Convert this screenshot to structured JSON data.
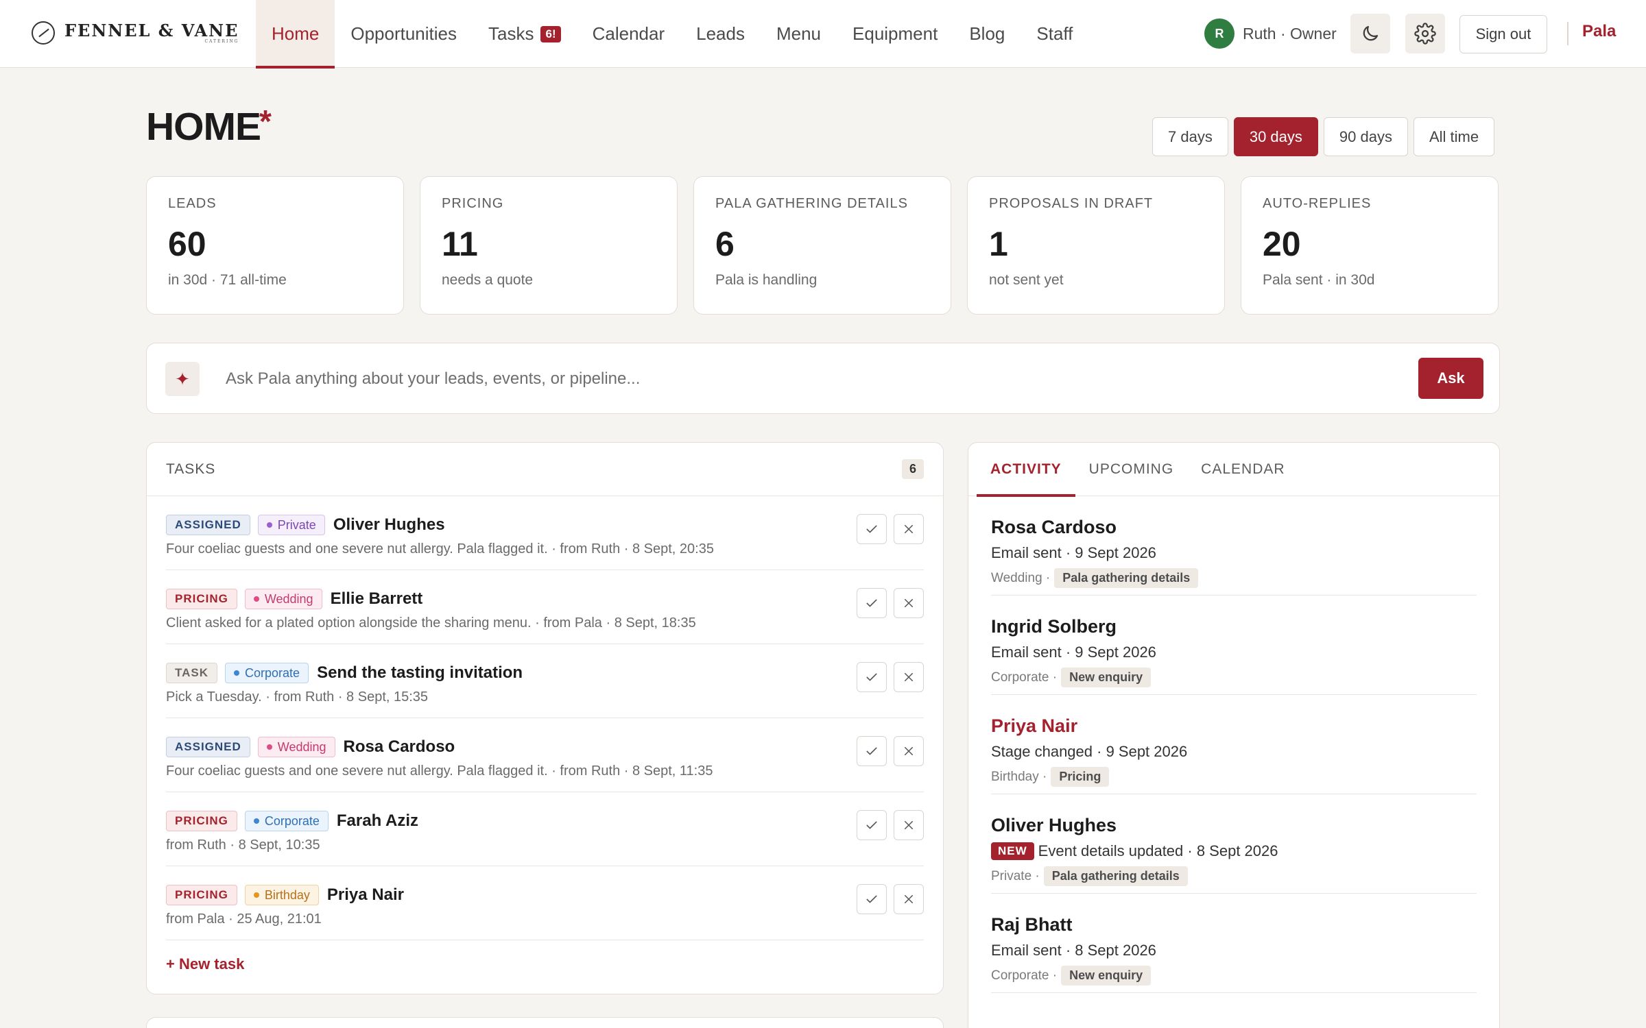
{
  "brand": {
    "name": "FENNEL & VANE",
    "sub": "CATERING"
  },
  "nav": {
    "items": [
      {
        "label": "Home",
        "active": true
      },
      {
        "label": "Opportunities"
      },
      {
        "label": "Tasks",
        "badge": "6!"
      },
      {
        "label": "Calendar"
      },
      {
        "label": "Leads"
      },
      {
        "label": "Menu"
      },
      {
        "label": "Equipment"
      },
      {
        "label": "Blog"
      },
      {
        "label": "Staff"
      }
    ]
  },
  "user": {
    "initial": "R",
    "label": "Ruth · Owner"
  },
  "header_actions": {
    "signout": "Sign out",
    "pala": "Pala",
    "theme_icon": "moon-icon",
    "settings_icon": "gear-icon"
  },
  "page": {
    "title": "HOME",
    "star": "*"
  },
  "ranges": [
    {
      "label": "7 days"
    },
    {
      "label": "30 days",
      "active": true
    },
    {
      "label": "90 days"
    },
    {
      "label": "All time"
    }
  ],
  "stats": [
    {
      "label": "LEADS",
      "value": "60",
      "sub": "in 30d · 71 all-time"
    },
    {
      "label": "PRICING",
      "value": "11",
      "sub": "needs a quote"
    },
    {
      "label": "PALA GATHERING DETAILS",
      "value": "6",
      "sub": "Pala is handling"
    },
    {
      "label": "PROPOSALS IN DRAFT",
      "value": "1",
      "sub": "not sent yet"
    },
    {
      "label": "AUTO-REPLIES",
      "value": "20",
      "sub": "Pala sent · in 30d"
    }
  ],
  "ask": {
    "icon": "✦",
    "placeholder": "Ask Pala anything about your leads, events, or pipeline...",
    "button": "Ask"
  },
  "tasks": {
    "title": "TASKS",
    "count": "6",
    "new_task": "+ New task",
    "items": [
      {
        "status": "ASSIGNED",
        "type": "Private",
        "name": "Oliver Hughes",
        "desc": "Four coeliac guests and one severe nut allergy. Pala flagged it. · from Ruth · 8 Sept, 20:35"
      },
      {
        "status": "PRICING",
        "type": "Wedding",
        "name": "Ellie Barrett",
        "desc": "Client asked for a plated option alongside the sharing menu. · from Pala · 8 Sept, 18:35"
      },
      {
        "status": "TASK",
        "type": "Corporate",
        "name": "Send the tasting invitation",
        "desc": "Pick a Tuesday. · from Ruth · 8 Sept, 15:35"
      },
      {
        "status": "ASSIGNED",
        "type": "Wedding",
        "name": "Rosa Cardoso",
        "desc": "Four coeliac guests and one severe nut allergy. Pala flagged it. · from Ruth · 8 Sept, 11:35"
      },
      {
        "status": "PRICING",
        "type": "Corporate",
        "name": "Farah Aziz",
        "desc": "from Ruth · 8 Sept, 10:35"
      },
      {
        "status": "PRICING",
        "type": "Birthday",
        "name": "Priya Nair",
        "desc": "from Pala · 25 Aug, 21:01"
      }
    ]
  },
  "activity": {
    "tabs": [
      {
        "label": "ACTIVITY",
        "active": true
      },
      {
        "label": "UPCOMING"
      },
      {
        "label": "CALENDAR"
      }
    ],
    "items": [
      {
        "name": "Rosa Cardoso",
        "event": "Email sent · 9 Sept 2026",
        "type": "Wedding ·",
        "stage": "Pala gathering details"
      },
      {
        "name": "Ingrid Solberg",
        "event": "Email sent · 9 Sept 2026",
        "type": "Corporate ·",
        "stage": "New enquiry"
      },
      {
        "name": "Priya Nair",
        "event": "Stage changed · 9 Sept 2026",
        "type": "Birthday ·",
        "stage": "Pricing",
        "highlight": true
      },
      {
        "name": "Oliver Hughes",
        "badge": "NEW",
        "event": "Event details updated · 8 Sept 2026",
        "type": "Private ·",
        "stage": "Pala gathering details"
      },
      {
        "name": "Raj Bhatt",
        "event": "Email sent · 8 Sept 2026",
        "type": "Corporate ·",
        "stage": "New enquiry"
      }
    ]
  },
  "colors": {
    "accent": "#a3222d",
    "status": {
      "ASSIGNED": {
        "bg": "#e9eef6",
        "border": "#c3d0e3",
        "text": "#2c4a78"
      },
      "PRICING": {
        "bg": "#fbeaea",
        "border": "#efc0c3",
        "text": "#a3222d"
      },
      "TASK": {
        "bg": "#f1eeea",
        "border": "#ddd7d0",
        "text": "#6b6560"
      }
    },
    "types": {
      "Private": {
        "bg": "#f5eefb",
        "border": "#d9c4ef",
        "text": "#7b48b3",
        "dot": "#9b5fd3"
      },
      "Wedding": {
        "bg": "#fcecf2",
        "border": "#efbcd0",
        "text": "#c23a6e",
        "dot": "#dc4d85"
      },
      "Corporate": {
        "bg": "#ebf3fc",
        "border": "#b9d4f0",
        "text": "#2e6fb5",
        "dot": "#3f85d2"
      },
      "Birthday": {
        "bg": "#fdf3e2",
        "border": "#f0d3a1",
        "text": "#b5701b",
        "dot": "#e09524"
      }
    }
  }
}
